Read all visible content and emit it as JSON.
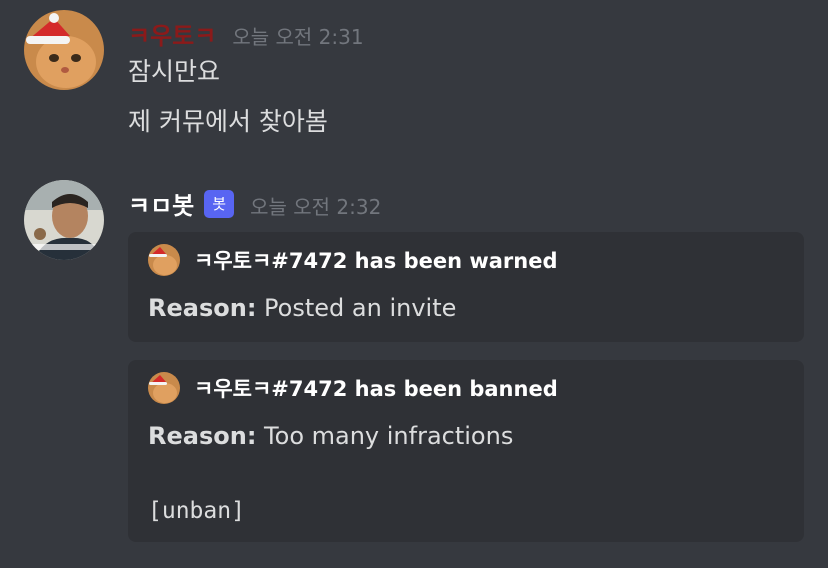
{
  "messages": [
    {
      "username": "ㅋ우토ㅋ",
      "username_color": "#8b1a1a",
      "timestamp": "오늘 오전 2:31",
      "avatar_icon": "cat-with-santa-hat-avatar",
      "lines": [
        "잠시만요",
        "제 커뮤에서 찾아봄"
      ]
    },
    {
      "username": "ㅋㅁ봇",
      "username_color": "#ffffff",
      "bot_tag": "봇",
      "timestamp": "오늘 오전 2:32",
      "avatar_icon": "man-portrait-avatar",
      "embeds": [
        {
          "author": "ㅋ우토ㅋ#7472 has been warned",
          "reason_label": "Reason:",
          "reason_text": " Posted an invite"
        },
        {
          "author": "ㅋ우토ㅋ#7472 has been banned",
          "reason_label": "Reason:",
          "reason_text": " Too many infractions",
          "code": "[unban]"
        }
      ]
    }
  ],
  "colors": {
    "background": "#36393f",
    "embed_background": "#2f3136",
    "timestamp": "#72767d",
    "bot_tag": "#5865f2"
  }
}
